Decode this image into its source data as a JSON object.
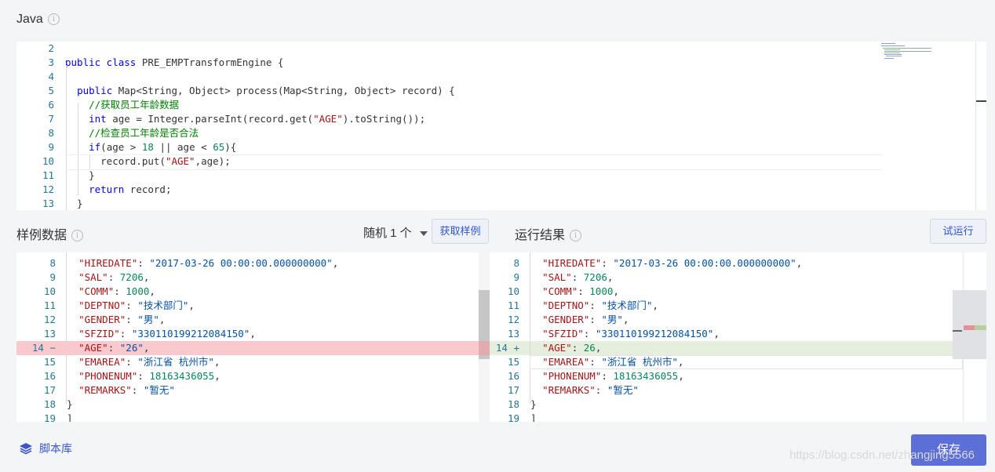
{
  "editor": {
    "language": "Java",
    "info_icon": "i",
    "lines": [
      {
        "n": "2",
        "html": ""
      },
      {
        "n": "3",
        "html": "<span class=\"kw\">public class</span> PRE_EMPTransformEngine {"
      },
      {
        "n": "4",
        "html": ""
      },
      {
        "n": "5",
        "html": "  <span class=\"kw\">public</span> Map&lt;String, Object&gt; process(Map&lt;String, Object&gt; record) {"
      },
      {
        "n": "6",
        "html": "    <span class=\"cm\">//获取员工年龄数据</span>"
      },
      {
        "n": "7",
        "html": "    <span class=\"kw\">int</span> age = Integer.parseInt(record.get(<span class=\"str\">\"AGE\"</span>).toString());"
      },
      {
        "n": "8",
        "html": "    <span class=\"cm\">//检查员工年龄是否合法</span>"
      },
      {
        "n": "9",
        "html": "    <span class=\"kw\">if</span>(age &gt; <span class=\"num\">18</span> || age &lt; <span class=\"num\">65</span>){"
      },
      {
        "n": "10",
        "html": "      record.put(<span class=\"str\">\"AGE\"</span>,age);"
      },
      {
        "n": "11",
        "html": "    }"
      },
      {
        "n": "12",
        "html": "    <span class=\"kw\">return</span> record;"
      },
      {
        "n": "13",
        "html": "  }"
      }
    ]
  },
  "sample": {
    "title": "样例数据",
    "random_label": "随机 1 个",
    "fetch_button": "获取样例",
    "lines": [
      {
        "n": "8",
        "html": "  <span class=\"key\">\"HIREDATE\"</span>: <span class=\"sval\">\"2017-03-26 00:00:00.000000000\"</span>,"
      },
      {
        "n": "9",
        "html": "  <span class=\"key\">\"SAL\"</span>: <span class=\"num\">7206</span>,"
      },
      {
        "n": "10",
        "html": "  <span class=\"key\">\"COMM\"</span>: <span class=\"num\">1000</span>,"
      },
      {
        "n": "11",
        "html": "  <span class=\"key\">\"DEPTNO\"</span>: <span class=\"sval\">\"技术部门\"</span>,"
      },
      {
        "n": "12",
        "html": "  <span class=\"key\">\"GENDER\"</span>: <span class=\"sval\">\"男\"</span>,"
      },
      {
        "n": "13",
        "html": "  <span class=\"key\">\"SFZID\"</span>: <span class=\"sval\">\"330110199212084150\"</span>,"
      },
      {
        "n": "14 −",
        "html": "  <span class=\"key\">\"AGE\"</span>: <span class=\"sval\">\"26\"</span>,"
      },
      {
        "n": "15",
        "html": "  <span class=\"key\">\"EMAREA\"</span>: <span class=\"sval\">\"浙江省 杭州市\"</span>,"
      },
      {
        "n": "16",
        "html": "  <span class=\"key\">\"PHONENUM\"</span>: <span class=\"num\">18163436055</span>,"
      },
      {
        "n": "17",
        "html": "  <span class=\"key\">\"REMARKS\"</span>: <span class=\"sval\">\"暂无\"</span>"
      },
      {
        "n": "18",
        "html": "}"
      },
      {
        "n": "19",
        "html": "]"
      }
    ]
  },
  "result": {
    "title": "运行结果",
    "run_button": "试运行",
    "lines": [
      {
        "n": "8",
        "html": "  <span class=\"key\">\"HIREDATE\"</span>: <span class=\"sval\">\"2017-03-26 00:00:00.000000000\"</span>,"
      },
      {
        "n": "9",
        "html": "  <span class=\"key\">\"SAL\"</span>: <span class=\"num\">7206</span>,"
      },
      {
        "n": "10",
        "html": "  <span class=\"key\">\"COMM\"</span>: <span class=\"num\">1000</span>,"
      },
      {
        "n": "11",
        "html": "  <span class=\"key\">\"DEPTNO\"</span>: <span class=\"sval\">\"技术部门\"</span>,"
      },
      {
        "n": "12",
        "html": "  <span class=\"key\">\"GENDER\"</span>: <span class=\"sval\">\"男\"</span>,"
      },
      {
        "n": "13",
        "html": "  <span class=\"key\">\"SFZID\"</span>: <span class=\"sval\">\"330110199212084150\"</span>,"
      },
      {
        "n": "14 +",
        "html": "  <span class=\"key\">\"AGE\"</span>: <span class=\"num\">26</span>,"
      },
      {
        "n": "15",
        "html": "  <span class=\"key\">\"EMAREA\"</span>: <span class=\"sval\">\"浙江省 杭州市\"</span>,"
      },
      {
        "n": "16",
        "html": "  <span class=\"key\">\"PHONENUM\"</span>: <span class=\"num\">18163436055</span>,"
      },
      {
        "n": "17",
        "html": "  <span class=\"key\">\"REMARKS\"</span>: <span class=\"sval\">\"暂无\"</span>"
      },
      {
        "n": "18",
        "html": "}"
      },
      {
        "n": "19",
        "html": "]"
      }
    ]
  },
  "footer": {
    "library_label": "脚本库",
    "save_label": "保存",
    "watermark": "https://blog.csdn.net/zhangjing5566"
  },
  "colors": {
    "removed_line": "#f9c9cd",
    "added_line": "#e6eedd",
    "primary": "#5b6fd6"
  }
}
